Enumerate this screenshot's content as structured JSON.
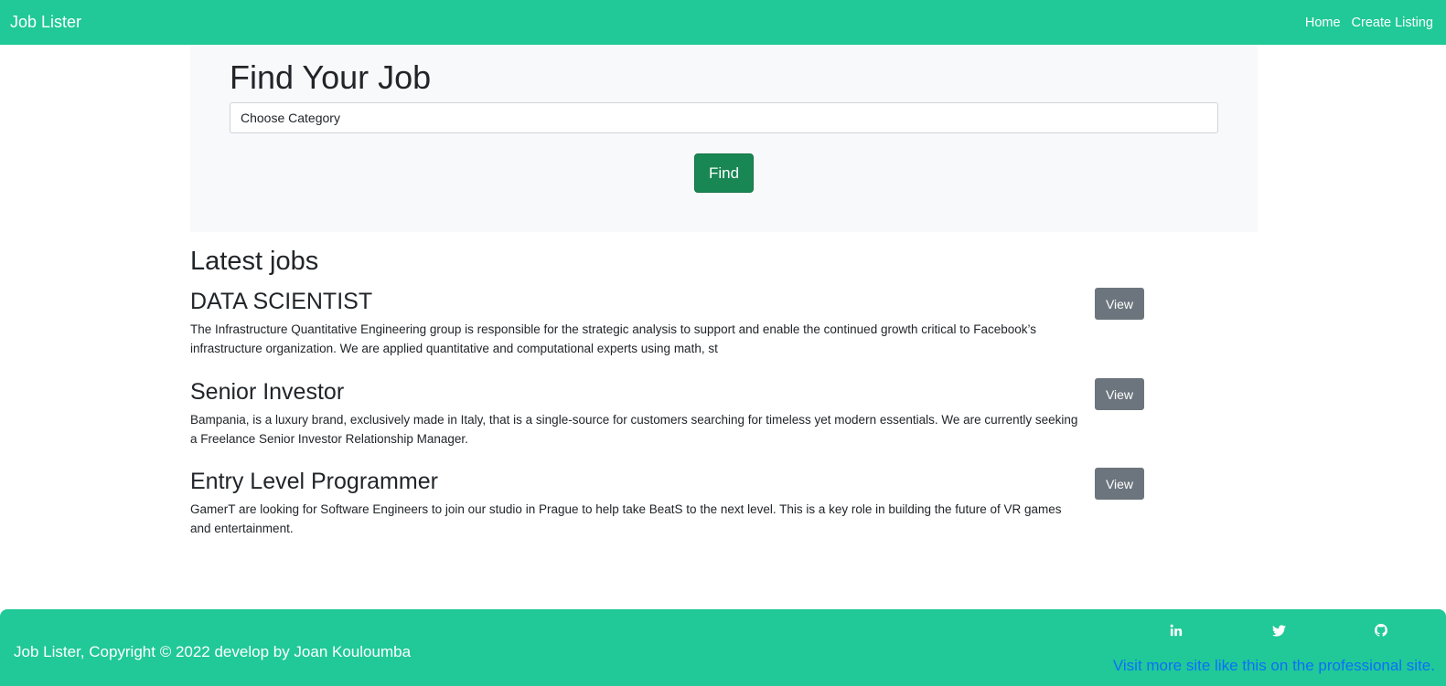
{
  "navbar": {
    "brand": "Job Lister",
    "links": [
      "Home",
      "Create Listing"
    ]
  },
  "search": {
    "heading": "Find Your Job",
    "category_value": "Choose Category",
    "button_label": "Find"
  },
  "latest": {
    "heading": "Latest jobs",
    "jobs": [
      {
        "title": "DATA SCIENTIST",
        "description": "The Infrastructure Quantitative Engineering group is responsible for the strategic analysis to support and enable the continued growth critical to Facebook’s infrastructure organization. We are applied quantitative and computational experts using math, st",
        "button_label": "View"
      },
      {
        "title": "Senior Investor",
        "description": "Bampania, is a luxury brand, exclusively made in Italy, that is a single-source for customers searching for timeless yet modern essentials. We are currently seeking a Freelance Senior Investor Relationship Manager.",
        "button_label": "View"
      },
      {
        "title": "Entry Level Programmer",
        "description": "GamerT are looking for Software Engineers to join our studio in Prague to help take BeatS to the next level. This is a key role in building the future of VR games and entertainment.",
        "button_label": "View"
      }
    ]
  },
  "footer": {
    "copyright": "Job Lister, Copyright © 2022 develop by Joan Kouloumba",
    "social_icons": [
      "linkedin-icon",
      "twitter-icon",
      "github-icon"
    ],
    "link_text": "Visit more site like this on the professional site."
  },
  "colors": {
    "brand": "#20c997",
    "find_button": "#198754",
    "view_button": "#6c757d",
    "link": "#0d6efd"
  }
}
